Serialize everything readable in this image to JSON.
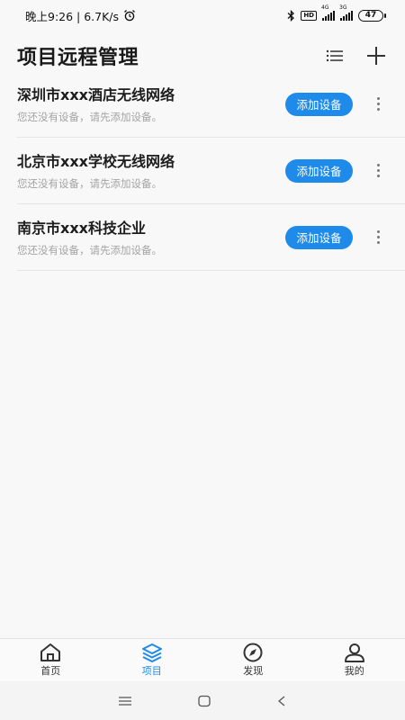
{
  "status_bar": {
    "time_text": "晚上9:26 | 6.7K/s",
    "hd_label": "HD",
    "sim1_type": "4G",
    "sim2_type": "3G",
    "battery_level": "47"
  },
  "header": {
    "title": "项目远程管理"
  },
  "projects": [
    {
      "name": "深圳市xxx酒店无线网络",
      "subtitle": "您还没有设备，请先添加设备。",
      "action_label": "添加设备"
    },
    {
      "name": "北京市xxx学校无线网络",
      "subtitle": "您还没有设备，请先添加设备。",
      "action_label": "添加设备"
    },
    {
      "name": "南京市xxx科技企业",
      "subtitle": "您还没有设备，请先添加设备。",
      "action_label": "添加设备"
    }
  ],
  "bottom_nav": {
    "items": [
      {
        "label": "首页",
        "icon": "home-icon",
        "active": false
      },
      {
        "label": "项目",
        "icon": "layers-icon",
        "active": true
      },
      {
        "label": "发现",
        "icon": "compass-icon",
        "active": false
      },
      {
        "label": "我的",
        "icon": "user-icon",
        "active": false
      }
    ]
  },
  "colors": {
    "accent": "#1e8bea",
    "background": "#f8f8f8",
    "subtitle_text": "#a4a4a4"
  }
}
